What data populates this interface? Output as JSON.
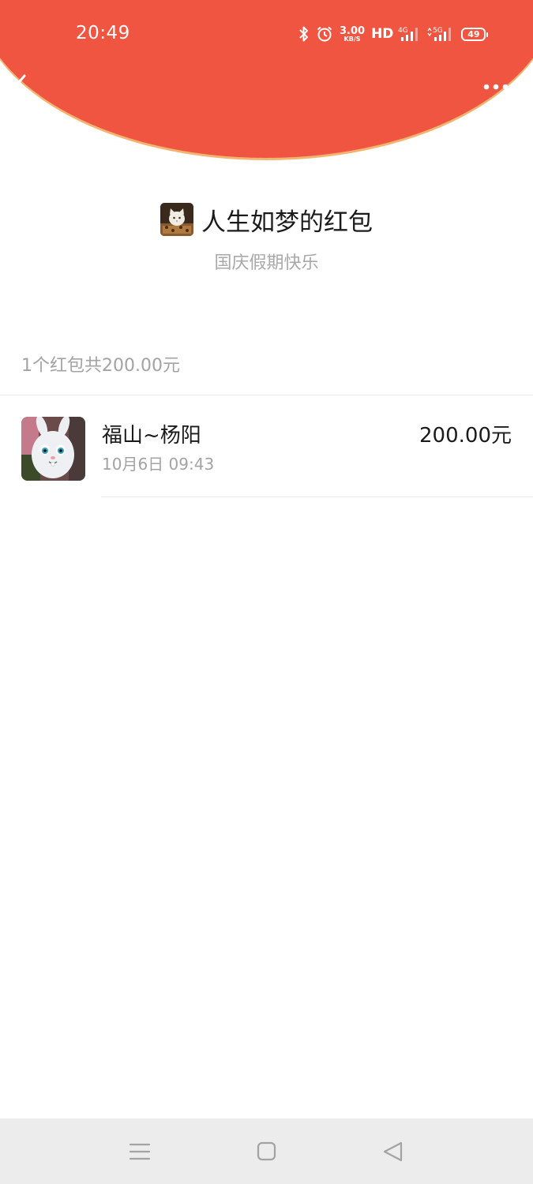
{
  "status_bar": {
    "time": "20:49",
    "net_speed_value": "3.00",
    "net_speed_unit": "KB/S",
    "hd_label": "HD",
    "signal_1_label": "4G",
    "signal_2_label": "5G",
    "battery_level": "49",
    "icons": [
      "bluetooth-icon",
      "alarm-icon",
      "signal-icon",
      "battery-icon"
    ]
  },
  "nav": {
    "back_icon": "chevron-left-icon",
    "more_icon": "more-dots-icon"
  },
  "packet": {
    "title": "人生如梦的红包",
    "greeting": "国庆假期快乐",
    "summary": "1个红包共200.00元"
  },
  "receivers": [
    {
      "name": "福山~杨阳",
      "time": "10月6日  09:43",
      "amount": "200.00元"
    }
  ],
  "system_nav": [
    "menu-icon",
    "home-square-icon",
    "back-triangle-icon"
  ],
  "colors": {
    "header_red": "#f05542",
    "header_edge": "#f3b470",
    "text_primary": "#1b1b1b",
    "text_secondary": "#a3a3a3",
    "nav_bg": "#ececec"
  }
}
